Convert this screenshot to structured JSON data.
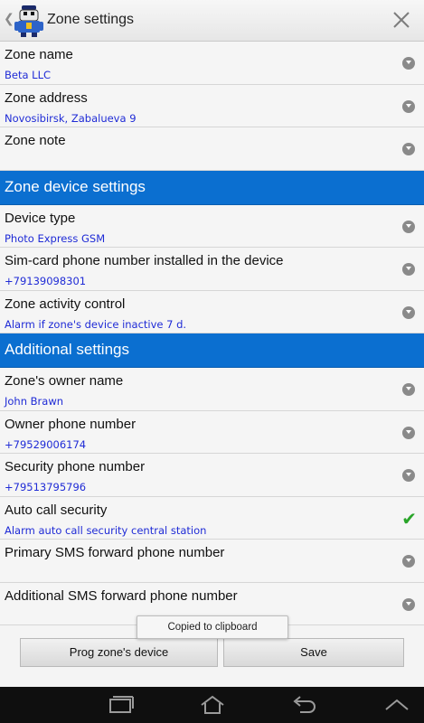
{
  "actionbar": {
    "title": "Zone settings",
    "up_glyph": "❮"
  },
  "zone_rows": [
    {
      "label": "Zone name",
      "value": "Beta LLC",
      "indicator": "chevron"
    },
    {
      "label": "Zone address",
      "value": "Novosibirsk, Zabalueva 9",
      "indicator": "chevron"
    },
    {
      "label": "Zone note",
      "value": "",
      "indicator": "chevron"
    }
  ],
  "sections": {
    "device": "Zone device settings",
    "additional": "Additional settings"
  },
  "device_rows": [
    {
      "label": "Device type",
      "value": "Photo Express GSM",
      "indicator": "chevron"
    },
    {
      "label": "Sim-card phone number installed in the device",
      "value": "+79139098301",
      "indicator": "chevron"
    },
    {
      "label": "Zone activity control",
      "value": "Alarm if zone's device inactive 7 d.",
      "indicator": "chevron"
    }
  ],
  "additional_rows": [
    {
      "label": "Zone's owner name",
      "value": "John Brawn",
      "indicator": "chevron"
    },
    {
      "label": "Owner phone number",
      "value": "+79529006174",
      "indicator": "chevron"
    },
    {
      "label": "Security phone number",
      "value": "+79513795796",
      "indicator": "chevron"
    },
    {
      "label": "Auto call security",
      "value": "Alarm auto call security central station",
      "indicator": "check"
    },
    {
      "label": "Primary SMS forward phone number",
      "value": "",
      "indicator": "chevron"
    },
    {
      "label": "Additional SMS forward phone number",
      "value": "",
      "indicator": "chevron"
    }
  ],
  "toast": "Copied to clipboard",
  "buttons": {
    "prog": "Prog zone's device",
    "save": "Save"
  },
  "colors": {
    "section_bg": "#0b6fd0",
    "value_text": "#1f2bd6",
    "check": "#2aa52a"
  }
}
